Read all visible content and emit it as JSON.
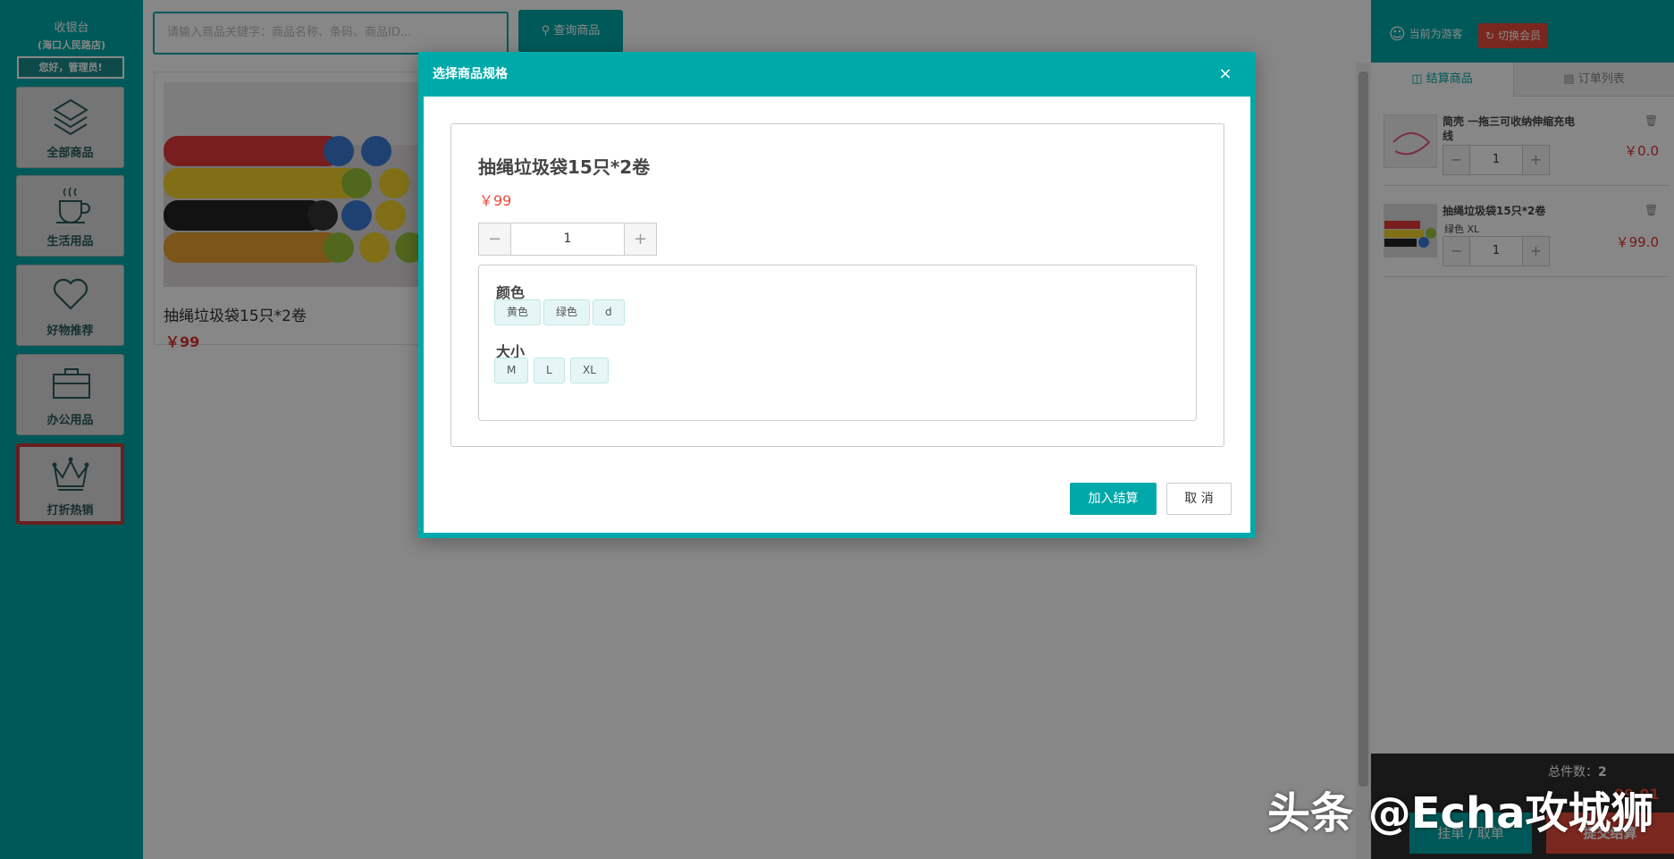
{
  "sidebar": {
    "brand_title": "收银台",
    "brand_sub": "(海口人民路店)",
    "greeting": "您好，管理员!",
    "items": [
      {
        "label": "全部商品",
        "icon": "layers-icon"
      },
      {
        "label": "生活用品",
        "icon": "coffee-cup-icon"
      },
      {
        "label": "好物推荐",
        "icon": "heart-icon"
      },
      {
        "label": "办公用品",
        "icon": "briefcase-icon"
      },
      {
        "label": "打折热销",
        "icon": "crown-icon"
      }
    ]
  },
  "search": {
    "placeholder": "请输入商品关键字：商品名称、条码、商品ID...",
    "button_label": "查询商品"
  },
  "products": [
    {
      "name": "抽绳垃圾袋15只*2卷",
      "price": "￥99"
    }
  ],
  "right_panel": {
    "guest_label": "当前为游客",
    "switch_label": "切换会员",
    "tabs": [
      "结算商品",
      "订单列表"
    ],
    "cart": [
      {
        "name": "简壳 一拖三可收纳伸缩充电线",
        "spec": "",
        "qty": "1",
        "price": "￥0.0"
      },
      {
        "name": "抽绳垃圾袋15只*2卷",
        "spec": "绿色  XL",
        "qty": "1",
        "price": "￥99.0"
      }
    ],
    "total_count_label": "总件数：",
    "total_count": "2",
    "total_amount": "99.01",
    "hold_label": "挂单 / 取单",
    "submit_label": "提交结算"
  },
  "modal": {
    "title": "选择商品规格",
    "close": "×",
    "product_name": "抽绳垃圾袋15只*2卷",
    "price": "￥99",
    "qty": "1",
    "minus": "−",
    "plus": "+",
    "spec_groups": [
      {
        "name": "颜色",
        "options": [
          "黄色",
          "绿色",
          "d"
        ]
      },
      {
        "name": "大小",
        "options": [
          "M",
          "L",
          "XL"
        ]
      }
    ],
    "add_label": "加入结算",
    "cancel_label": "取 消"
  },
  "watermark": "头条 @Echa攻城狮",
  "colors": {
    "accent": "#00a9a9",
    "danger": "#e74c3c"
  }
}
